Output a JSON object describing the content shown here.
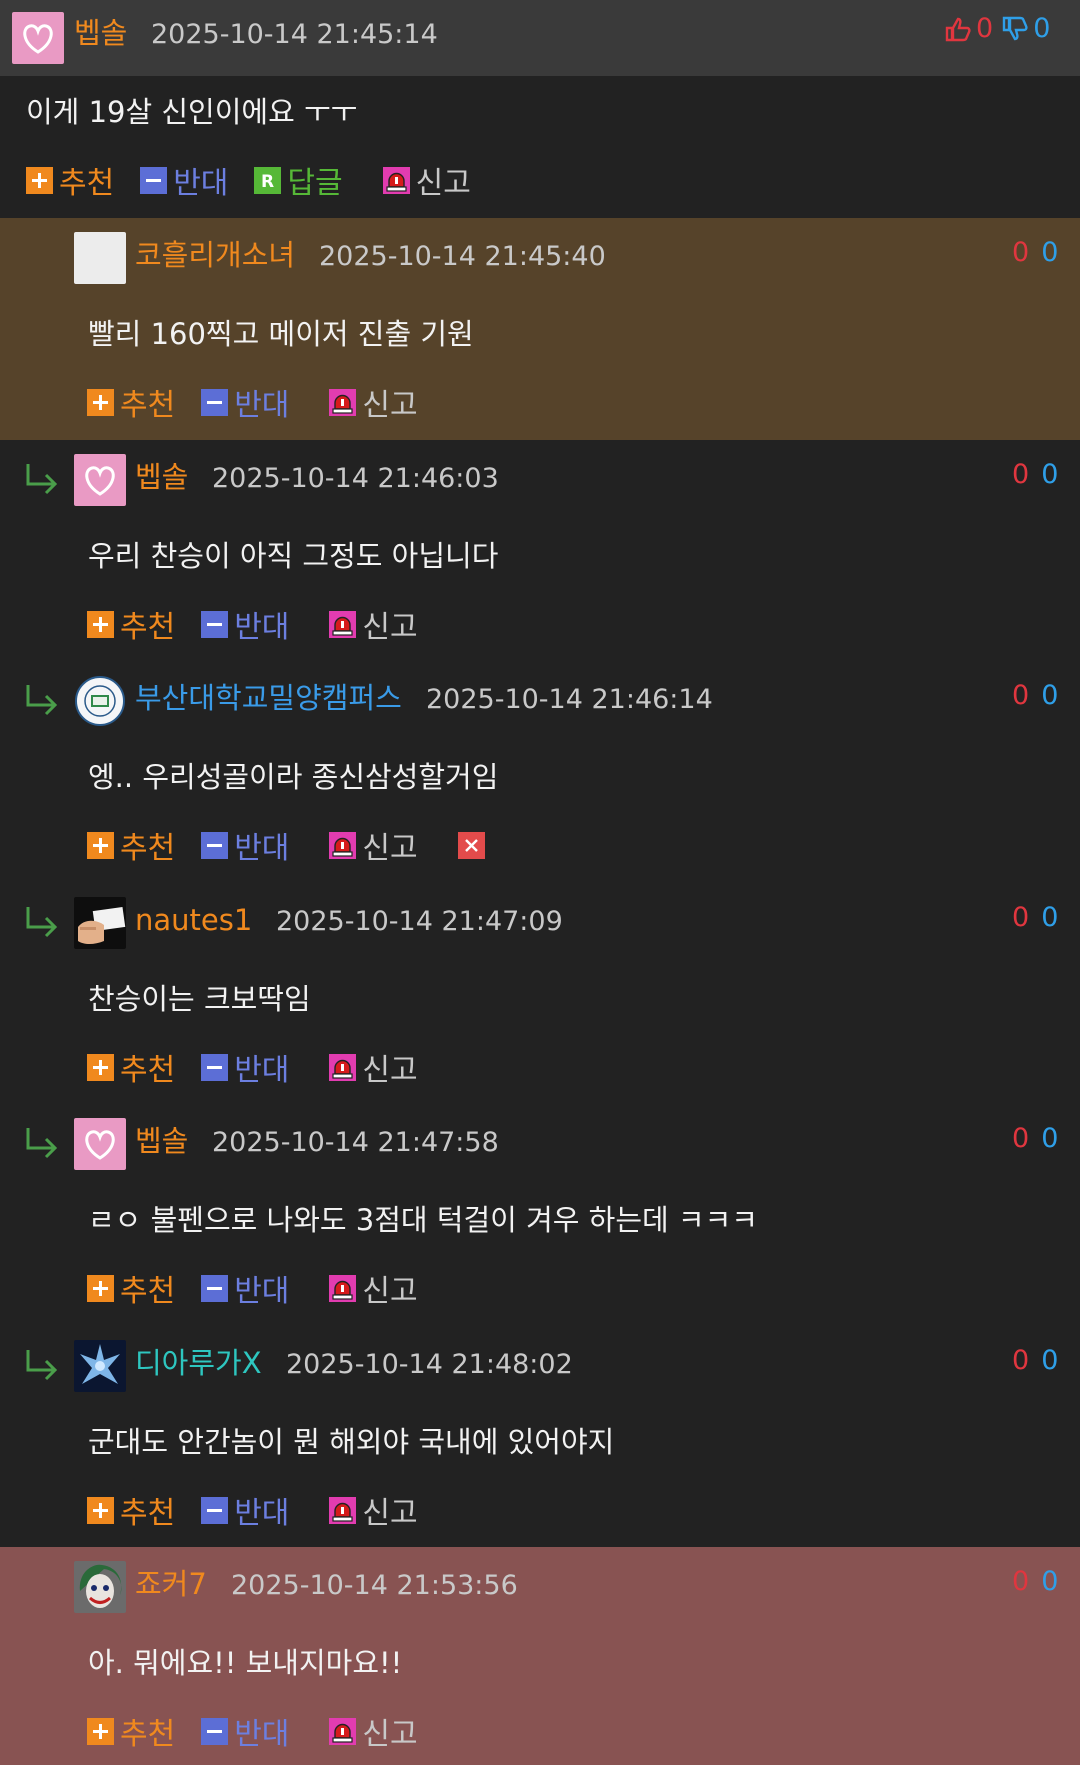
{
  "post": {
    "author": "벱솔",
    "author_color": "#f0891e",
    "timestamp": "2025-10-14 21:45:14",
    "upvotes": "0",
    "downvotes": "0",
    "content": "이게 19살 신인이에요 ㅜㅜ",
    "actions": {
      "recommend": "추천",
      "oppose": "반대",
      "reply": "답글",
      "report": "신고"
    }
  },
  "comments": [
    {
      "author": "코흘리개소녀",
      "author_color": "#f0891e",
      "timestamp": "2025-10-14 21:45:40",
      "upvotes": "0",
      "downvotes": "0",
      "content": "빨리 160찍고 메이저 진출 기원",
      "is_reply": false,
      "avatar": "blank-avatar",
      "bg": "#56432a",
      "has_delete": false
    },
    {
      "author": "벱솔",
      "author_color": "#f0891e",
      "timestamp": "2025-10-14 21:46:03",
      "upvotes": "0",
      "downvotes": "0",
      "content": "우리 찬승이 아직 그정도 아닙니다",
      "is_reply": true,
      "avatar": "heart-avatar",
      "bg": "#222222",
      "has_delete": false
    },
    {
      "author": "부산대학교밀양캠퍼스",
      "author_color": "#3a9be8",
      "timestamp": "2025-10-14 21:46:14",
      "upvotes": "0",
      "downvotes": "0",
      "content": "엥.. 우리성골이라 종신삼성할거임",
      "is_reply": true,
      "avatar": "university-seal-avatar",
      "bg": "#222222",
      "has_delete": true
    },
    {
      "author": "nautes1",
      "author_color": "#f0891e",
      "timestamp": "2025-10-14 21:47:09",
      "upvotes": "0",
      "downvotes": "0",
      "content": "찬승이는 크보딱임",
      "is_reply": true,
      "avatar": "hand-card-avatar",
      "bg": "#222222",
      "has_delete": false
    },
    {
      "author": "벱솔",
      "author_color": "#f0891e",
      "timestamp": "2025-10-14 21:47:58",
      "upvotes": "0",
      "downvotes": "0",
      "content": "ㄹㅇ 불펜으로 나와도 3점대 턱걸이 겨우 하는데 ㅋㅋㅋ",
      "is_reply": true,
      "avatar": "heart-avatar",
      "bg": "#222222",
      "has_delete": false
    },
    {
      "author": "디아루가X",
      "author_color": "#2ec7c0",
      "timestamp": "2025-10-14 21:48:02",
      "upvotes": "0",
      "downvotes": "0",
      "content": "군대도 안간놈이 뭔 해외야 국내에 있어야지",
      "is_reply": true,
      "avatar": "dragon-avatar",
      "bg": "#222222",
      "has_delete": false
    },
    {
      "author": "죠커7",
      "author_color": "#f0891e",
      "timestamp": "2025-10-14 21:53:56",
      "upvotes": "0",
      "downvotes": "0",
      "content": "아. 뭐에요!! 보내지마요!!",
      "is_reply": false,
      "avatar": "joker-avatar",
      "bg": "#885352",
      "has_delete": false
    }
  ],
  "comment_actions": {
    "recommend": "추천",
    "oppose": "반대",
    "report": "신고"
  }
}
